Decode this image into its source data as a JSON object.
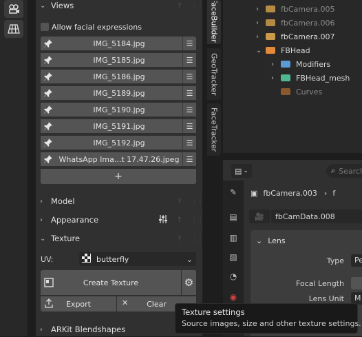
{
  "left_toolbar": {
    "icons": [
      "camera-icon",
      "grid-icon"
    ]
  },
  "views": {
    "title": "Views",
    "allow_label": "Allow facial expressions",
    "allow_checked": false,
    "images": [
      "IMG_5184.jpg",
      "IMG_5185.jpg",
      "IMG_5186.jpg",
      "IMG_5189.jpg",
      "IMG_5190.jpg",
      "IMG_5191.jpg",
      "IMG_5192.jpg",
      "WhatsApp Ima...t 17.47.26.jpeg"
    ],
    "add_label": "+"
  },
  "sections": {
    "model": "Model",
    "appearance": "Appearance",
    "texture": "Texture",
    "arkit": "ARKit Blendshapes"
  },
  "texture": {
    "uv_label": "UV:",
    "uv_value": "butterfly",
    "create_label": "Create Texture",
    "export_label": "Export",
    "clear_label": "Clear"
  },
  "tabs": [
    "FaceBuilder",
    "GeoTracker",
    "FaceTracker"
  ],
  "outliner": {
    "items": [
      {
        "label": "fbCamera.005",
        "dim": true,
        "color": "#b58a45"
      },
      {
        "label": "fbCamera.006",
        "dim": true,
        "color": "#b58a45"
      },
      {
        "label": "fbCamera.007",
        "dim": false,
        "color": "#c99a4a"
      },
      {
        "label": "FBHead",
        "dim": false,
        "color": "#e38b3a"
      },
      {
        "label": "Modifiers",
        "dim": false,
        "color": "#5b9bd5"
      },
      {
        "label": "FBHead_mesh",
        "dim": false,
        "color": "#4fb88f"
      },
      {
        "label": "Curves",
        "dim": true,
        "color": "#8a5a2e"
      }
    ]
  },
  "properties": {
    "search_placeholder": "Search",
    "object_name": "fbCamera.003",
    "data_name": "fbCamData.008",
    "lens_section": "Lens",
    "fields": {
      "type": "Type",
      "type_value": "Pe",
      "focal_length": "Focal Length",
      "lens_unit": "Lens Unit",
      "lens_unit_value": "M"
    }
  },
  "tooltip": {
    "title": "Texture settings",
    "description": "Source images, size and other texture settings."
  }
}
